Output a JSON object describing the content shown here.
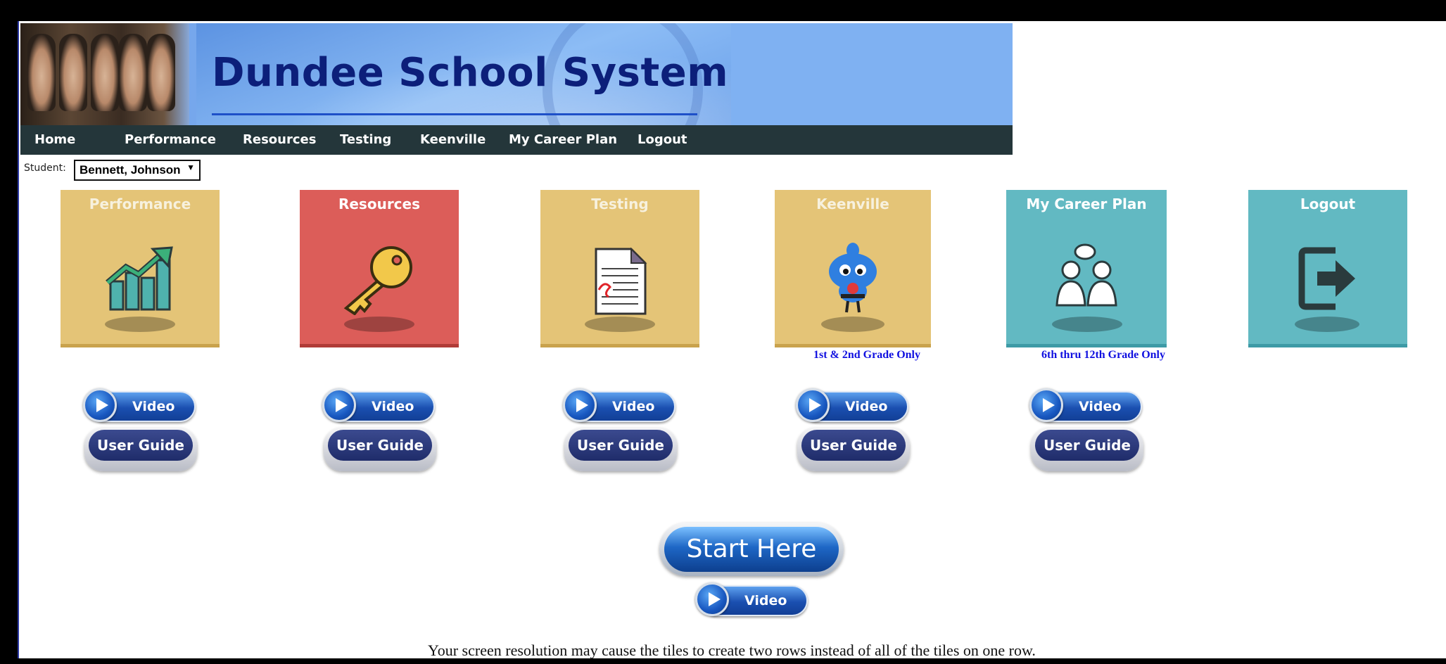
{
  "site": {
    "title": "Dundee School System"
  },
  "nav": {
    "items": [
      "Home",
      "Performance",
      "Resources",
      "Testing",
      "Keenville",
      "My Career Plan",
      "Logout"
    ]
  },
  "student": {
    "label": "Student:",
    "selected": "Bennett, Johnson"
  },
  "tiles": [
    {
      "title": "Performance",
      "icon": "chart-arrow-icon",
      "color": "#e4c477",
      "note": ""
    },
    {
      "title": "Resources",
      "icon": "key-icon",
      "color": "#dc5d59",
      "note": ""
    },
    {
      "title": "Testing",
      "icon": "document-icon",
      "color": "#e4c477",
      "note": ""
    },
    {
      "title": "Keenville",
      "icon": "mascot-icon",
      "color": "#e4c477",
      "note": "1st & 2nd Grade Only"
    },
    {
      "title": "My Career Plan",
      "icon": "people-talking-icon",
      "color": "#62b9c2",
      "note": "6th thru 12th Grade Only"
    },
    {
      "title": "Logout",
      "icon": "logout-icon",
      "color": "#62b9c2",
      "note": ""
    }
  ],
  "buttons": {
    "video_label": "Video",
    "guide_label": "User Guide",
    "start_label": "Start Here"
  },
  "footer_note": "Your screen resolution may cause the tiles to create two rows instead of all of the tiles on one row."
}
